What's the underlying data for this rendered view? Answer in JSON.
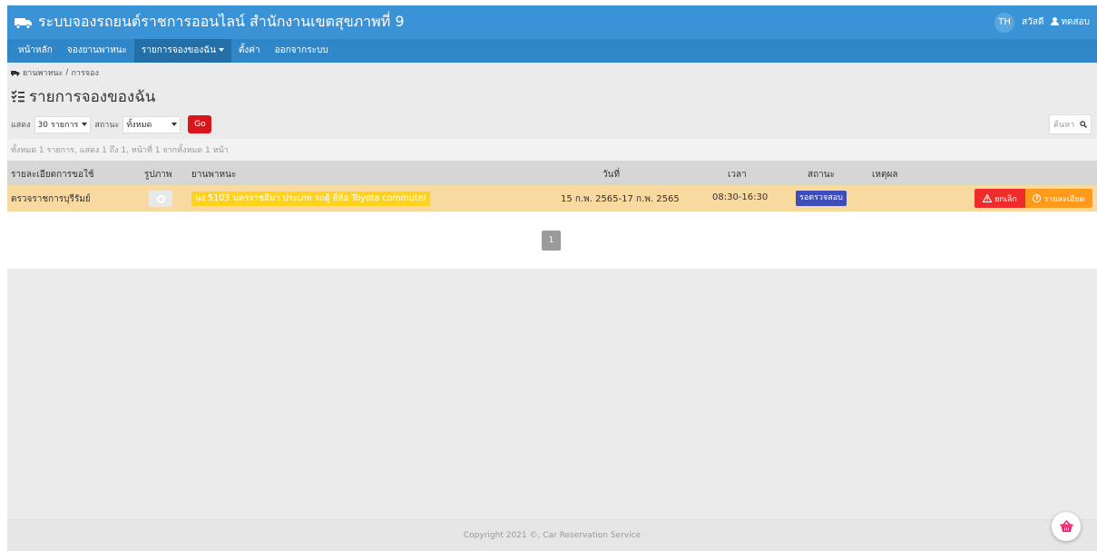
{
  "header": {
    "title": "ระบบจองรถยนต์ราชการออนไลน์ สำนักงานเขตสุขภาพที่ 9",
    "lang": "TH",
    "greeting": "สวัสดี",
    "username": "ทดสอบ"
  },
  "nav": {
    "items": [
      {
        "label": "หน้าหลัก"
      },
      {
        "label": "จองยานพาหนะ"
      },
      {
        "label": "รายการจองของฉัน"
      },
      {
        "label": "ตั้งค่า"
      },
      {
        "label": "ออกจากระบบ"
      }
    ]
  },
  "breadcrumb": {
    "parent": "ยานพาหนะ",
    "separator": "/",
    "current": "การจอง"
  },
  "page": {
    "title": "รายการจองของฉัน"
  },
  "filters": {
    "show_label": "แสดง",
    "page_size": "30 รายการ",
    "status_label": "สถานะ",
    "status_value": "ทั้งหมด",
    "go_label": "Go",
    "search_placeholder": "ค้นหา"
  },
  "summary": "ทั้งหมด 1 รายการ, แสดง 1 ถึง 1, หน้าที่ 1 จากทั้งหมด 1 หน้า",
  "table": {
    "headers": {
      "detail": "รายละเอียดการขอใช้",
      "photo": "รูปภาพ",
      "vehicle": "ยานพาหนะ",
      "date": "วันที่",
      "time": "เวลา",
      "status": "สถานะ",
      "reason": "เหตุผล"
    },
    "rows": [
      {
        "detail": "ตรวจราชการบุรีรัมย์",
        "vehicle": "นง 5103 นครราชสีมา ประเภท รถตู้ ยี่ห้อ Toyota commuter",
        "date": "15 ก.พ. 2565-17 ก.พ. 2565",
        "time": "08:30-16:30",
        "status": "รอตรวจสอบ",
        "reason": "",
        "cancel_label": "ยกเลิก",
        "detail_label": "รายละเอียด"
      }
    ]
  },
  "pagination": {
    "current": "1"
  },
  "footer": "Copyright 2021 ©, Car Reservation Service",
  "colors": {
    "header": "#3a93d6",
    "nav": "#2f86c8",
    "row_highlight": "#f8d9a0",
    "vehicle_tag": "#ffd21f",
    "status_badge": "#3e4db8",
    "cancel": "#ef2c2c",
    "detail": "#ff9a1a",
    "go": "#d9161c"
  }
}
